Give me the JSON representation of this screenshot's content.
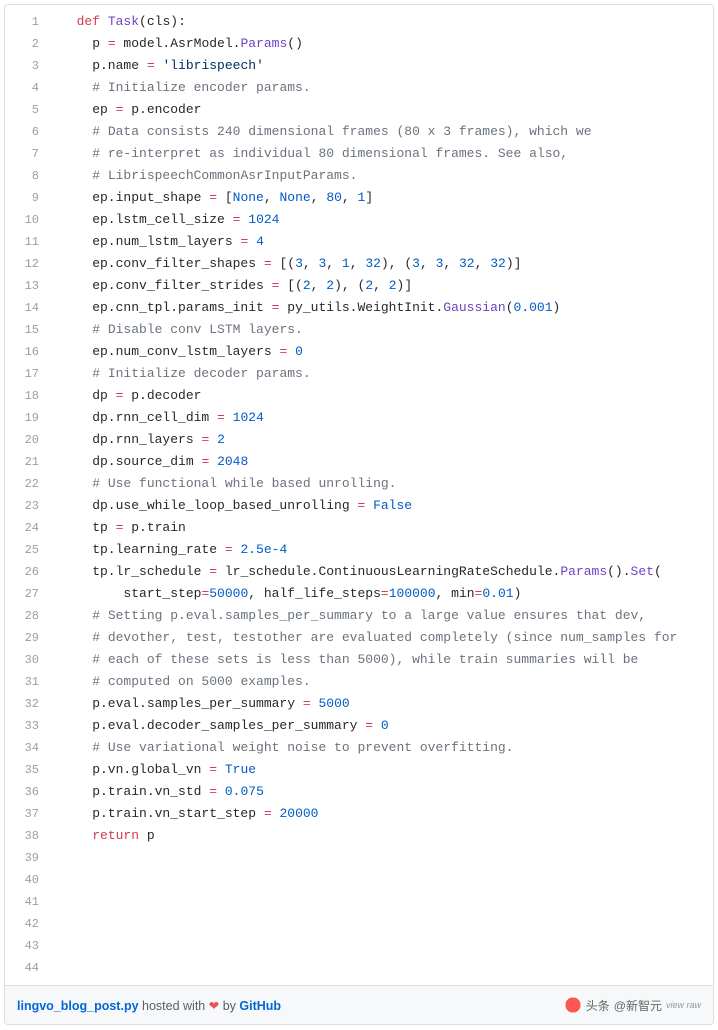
{
  "meta": {
    "filename": "lingvo_blog_post.py",
    "hosted_text": " hosted with ",
    "heart": "❤",
    "by_text": " by ",
    "host_name": "GitHub",
    "watermark_prefix": "头条",
    "watermark_at": "@新智元",
    "watermark_small": "view raw"
  },
  "code": {
    "lines": [
      {
        "n": 1,
        "segs": [
          [
            "  ",
            ""
          ],
          [
            "def",
            "kw"
          ],
          [
            " ",
            ""
          ],
          [
            "Task",
            "fn"
          ],
          [
            "(",
            ""
          ],
          [
            "cls",
            "p"
          ],
          [
            "):",
            ""
          ]
        ]
      },
      {
        "n": 2,
        "segs": [
          [
            "    p ",
            ""
          ],
          [
            "=",
            "op"
          ],
          [
            " model.AsrModel.",
            ""
          ],
          [
            "Params",
            "fn"
          ],
          [
            "()",
            ""
          ]
        ]
      },
      {
        "n": 3,
        "segs": [
          [
            "    p.name ",
            ""
          ],
          [
            "=",
            "op"
          ],
          [
            " ",
            ""
          ],
          [
            "'librispeech'",
            "str"
          ]
        ]
      },
      {
        "n": 4,
        "segs": [
          [
            "",
            ""
          ]
        ]
      },
      {
        "n": 5,
        "segs": [
          [
            "    ",
            ""
          ],
          [
            "# Initialize encoder params.",
            "cm"
          ]
        ]
      },
      {
        "n": 6,
        "segs": [
          [
            "    ep ",
            ""
          ],
          [
            "=",
            "op"
          ],
          [
            " p.encoder",
            ""
          ]
        ]
      },
      {
        "n": 7,
        "segs": [
          [
            "    ",
            ""
          ],
          [
            "# Data consists 240 dimensional frames (80 x 3 frames), which we",
            "cm"
          ]
        ]
      },
      {
        "n": 8,
        "segs": [
          [
            "    ",
            ""
          ],
          [
            "# re-interpret as individual 80 dimensional frames. See also,",
            "cm"
          ]
        ]
      },
      {
        "n": 9,
        "segs": [
          [
            "    ",
            ""
          ],
          [
            "# LibrispeechCommonAsrInputParams.",
            "cm"
          ]
        ]
      },
      {
        "n": 10,
        "segs": [
          [
            "    ep.input_shape ",
            ""
          ],
          [
            "=",
            "op"
          ],
          [
            " [",
            ""
          ],
          [
            "None",
            "const"
          ],
          [
            ", ",
            ""
          ],
          [
            "None",
            "const"
          ],
          [
            ", ",
            ""
          ],
          [
            "80",
            "num"
          ],
          [
            ", ",
            ""
          ],
          [
            "1",
            "num"
          ],
          [
            "]",
            ""
          ]
        ]
      },
      {
        "n": 11,
        "segs": [
          [
            "    ep.lstm_cell_size ",
            ""
          ],
          [
            "=",
            "op"
          ],
          [
            " ",
            ""
          ],
          [
            "1024",
            "num"
          ]
        ]
      },
      {
        "n": 12,
        "segs": [
          [
            "    ep.num_lstm_layers ",
            ""
          ],
          [
            "=",
            "op"
          ],
          [
            " ",
            ""
          ],
          [
            "4",
            "num"
          ]
        ]
      },
      {
        "n": 13,
        "segs": [
          [
            "    ep.conv_filter_shapes ",
            ""
          ],
          [
            "=",
            "op"
          ],
          [
            " [(",
            ""
          ],
          [
            "3",
            "num"
          ],
          [
            ", ",
            ""
          ],
          [
            "3",
            "num"
          ],
          [
            ", ",
            ""
          ],
          [
            "1",
            "num"
          ],
          [
            ", ",
            ""
          ],
          [
            "32",
            "num"
          ],
          [
            "), (",
            ""
          ],
          [
            "3",
            "num"
          ],
          [
            ", ",
            ""
          ],
          [
            "3",
            "num"
          ],
          [
            ", ",
            ""
          ],
          [
            "32",
            "num"
          ],
          [
            ", ",
            ""
          ],
          [
            "32",
            "num"
          ],
          [
            ")]",
            ""
          ]
        ]
      },
      {
        "n": 14,
        "segs": [
          [
            "    ep.conv_filter_strides ",
            ""
          ],
          [
            "=",
            "op"
          ],
          [
            " [(",
            ""
          ],
          [
            "2",
            "num"
          ],
          [
            ", ",
            ""
          ],
          [
            "2",
            "num"
          ],
          [
            "), (",
            ""
          ],
          [
            "2",
            "num"
          ],
          [
            ", ",
            ""
          ],
          [
            "2",
            "num"
          ],
          [
            ")]",
            ""
          ]
        ]
      },
      {
        "n": 15,
        "segs": [
          [
            "    ep.cnn_tpl.params_init ",
            ""
          ],
          [
            "=",
            "op"
          ],
          [
            " py_utils.WeightInit.",
            ""
          ],
          [
            "Gaussian",
            "fn"
          ],
          [
            "(",
            ""
          ],
          [
            "0.001",
            "num"
          ],
          [
            ")",
            ""
          ]
        ]
      },
      {
        "n": 16,
        "segs": [
          [
            "    ",
            ""
          ],
          [
            "# Disable conv LSTM layers.",
            "cm"
          ]
        ]
      },
      {
        "n": 17,
        "segs": [
          [
            "    ep.num_conv_lstm_layers ",
            ""
          ],
          [
            "=",
            "op"
          ],
          [
            " ",
            ""
          ],
          [
            "0",
            "num"
          ]
        ]
      },
      {
        "n": 18,
        "segs": [
          [
            "",
            ""
          ]
        ]
      },
      {
        "n": 19,
        "segs": [
          [
            "    ",
            ""
          ],
          [
            "# Initialize decoder params.",
            "cm"
          ]
        ]
      },
      {
        "n": 20,
        "segs": [
          [
            "    dp ",
            ""
          ],
          [
            "=",
            "op"
          ],
          [
            " p.decoder",
            ""
          ]
        ]
      },
      {
        "n": 21,
        "segs": [
          [
            "    dp.rnn_cell_dim ",
            ""
          ],
          [
            "=",
            "op"
          ],
          [
            " ",
            ""
          ],
          [
            "1024",
            "num"
          ]
        ]
      },
      {
        "n": 22,
        "segs": [
          [
            "    dp.rnn_layers ",
            ""
          ],
          [
            "=",
            "op"
          ],
          [
            " ",
            ""
          ],
          [
            "2",
            "num"
          ]
        ]
      },
      {
        "n": 23,
        "segs": [
          [
            "    dp.source_dim ",
            ""
          ],
          [
            "=",
            "op"
          ],
          [
            " ",
            ""
          ],
          [
            "2048",
            "num"
          ]
        ]
      },
      {
        "n": 24,
        "segs": [
          [
            "    ",
            ""
          ],
          [
            "# Use functional while based unrolling.",
            "cm"
          ]
        ]
      },
      {
        "n": 25,
        "segs": [
          [
            "    dp.use_while_loop_based_unrolling ",
            ""
          ],
          [
            "=",
            "op"
          ],
          [
            " ",
            ""
          ],
          [
            "False",
            "const"
          ]
        ]
      },
      {
        "n": 26,
        "segs": [
          [
            "",
            ""
          ]
        ]
      },
      {
        "n": 27,
        "segs": [
          [
            "    tp ",
            ""
          ],
          [
            "=",
            "op"
          ],
          [
            " p.train",
            ""
          ]
        ]
      },
      {
        "n": 28,
        "segs": [
          [
            "    tp.learning_rate ",
            ""
          ],
          [
            "=",
            "op"
          ],
          [
            " ",
            ""
          ],
          [
            "2.5e-4",
            "num"
          ]
        ]
      },
      {
        "n": 29,
        "segs": [
          [
            "    tp.lr_schedule ",
            ""
          ],
          [
            "=",
            "op"
          ],
          [
            " lr_schedule.ContinuousLearningRateSchedule.",
            ""
          ],
          [
            "Params",
            "fn"
          ],
          [
            "().",
            ""
          ],
          [
            "Set",
            "fn"
          ],
          [
            "(",
            ""
          ]
        ]
      },
      {
        "n": 30,
        "segs": [
          [
            "        ",
            ""
          ],
          [
            "start_step",
            "p"
          ],
          [
            "=",
            "op"
          ],
          [
            "",
            ""
          ],
          [
            "50000",
            "num"
          ],
          [
            ", ",
            ""
          ],
          [
            "half_life_steps",
            "p"
          ],
          [
            "=",
            "op"
          ],
          [
            "",
            ""
          ],
          [
            "100000",
            "num"
          ],
          [
            ", ",
            ""
          ],
          [
            "min",
            "p"
          ],
          [
            "=",
            "op"
          ],
          [
            "",
            ""
          ],
          [
            "0.01",
            "num"
          ],
          [
            ")",
            ""
          ]
        ]
      },
      {
        "n": 31,
        "segs": [
          [
            "",
            ""
          ]
        ]
      },
      {
        "n": 32,
        "segs": [
          [
            "    ",
            ""
          ],
          [
            "# Setting p.eval.samples_per_summary to a large value ensures that dev,",
            "cm"
          ]
        ]
      },
      {
        "n": 33,
        "segs": [
          [
            "    ",
            ""
          ],
          [
            "# devother, test, testother are evaluated completely (since num_samples for",
            "cm"
          ]
        ]
      },
      {
        "n": 34,
        "segs": [
          [
            "    ",
            ""
          ],
          [
            "# each of these sets is less than 5000), while train summaries will be",
            "cm"
          ]
        ]
      },
      {
        "n": 35,
        "segs": [
          [
            "    ",
            ""
          ],
          [
            "# computed on 5000 examples.",
            "cm"
          ]
        ]
      },
      {
        "n": 36,
        "segs": [
          [
            "    p.eval.samples_per_summary ",
            ""
          ],
          [
            "=",
            "op"
          ],
          [
            " ",
            ""
          ],
          [
            "5000",
            "num"
          ]
        ]
      },
      {
        "n": 37,
        "segs": [
          [
            "    p.eval.decoder_samples_per_summary ",
            ""
          ],
          [
            "=",
            "op"
          ],
          [
            " ",
            ""
          ],
          [
            "0",
            "num"
          ]
        ]
      },
      {
        "n": 38,
        "segs": [
          [
            "",
            ""
          ]
        ]
      },
      {
        "n": 39,
        "segs": [
          [
            "    ",
            ""
          ],
          [
            "# Use variational weight noise to prevent overfitting.",
            "cm"
          ]
        ]
      },
      {
        "n": 40,
        "segs": [
          [
            "    p.vn.global_vn ",
            ""
          ],
          [
            "=",
            "op"
          ],
          [
            " ",
            ""
          ],
          [
            "True",
            "const"
          ]
        ]
      },
      {
        "n": 41,
        "segs": [
          [
            "    p.train.vn_std ",
            ""
          ],
          [
            "=",
            "op"
          ],
          [
            " ",
            ""
          ],
          [
            "0.075",
            "num"
          ]
        ]
      },
      {
        "n": 42,
        "segs": [
          [
            "    p.train.vn_start_step ",
            ""
          ],
          [
            "=",
            "op"
          ],
          [
            " ",
            ""
          ],
          [
            "20000",
            "num"
          ]
        ]
      },
      {
        "n": 43,
        "segs": [
          [
            "",
            ""
          ]
        ]
      },
      {
        "n": 44,
        "segs": [
          [
            "    ",
            ""
          ],
          [
            "return",
            "kw"
          ],
          [
            " p",
            ""
          ]
        ]
      }
    ]
  }
}
